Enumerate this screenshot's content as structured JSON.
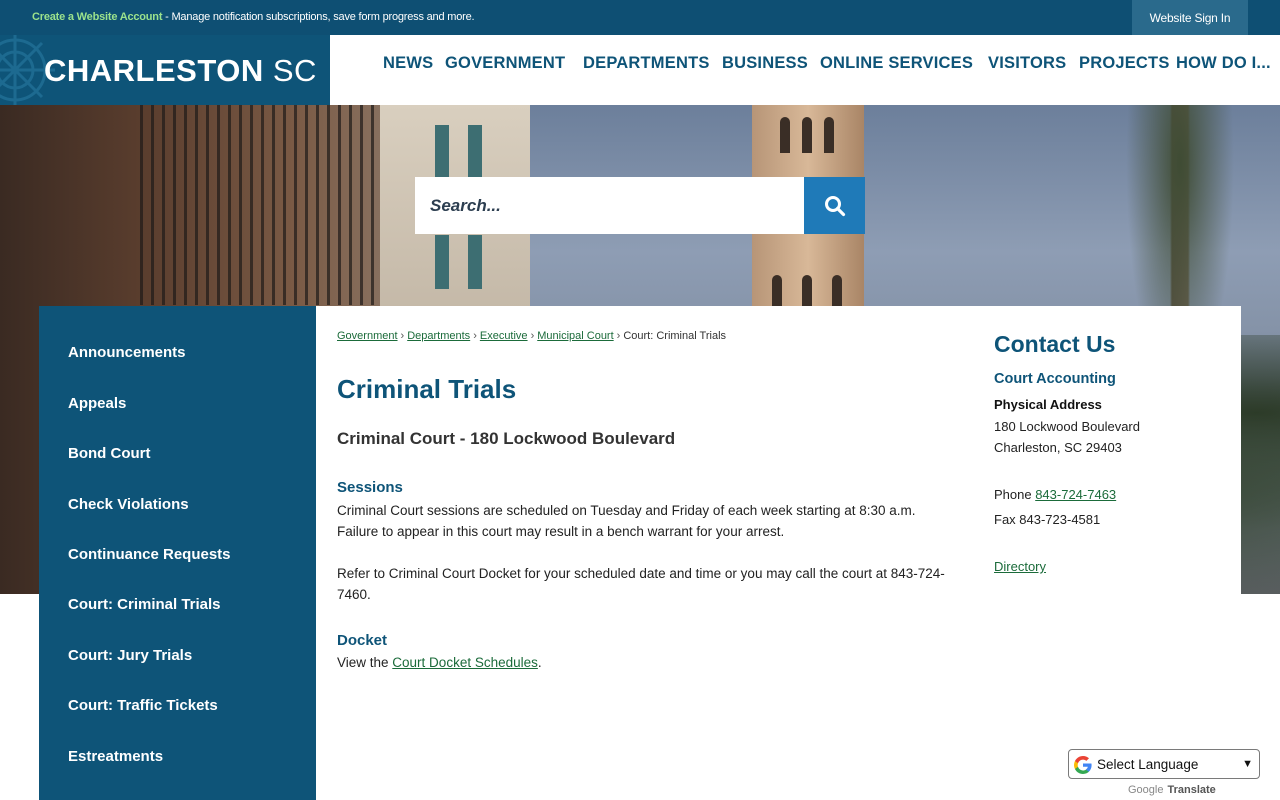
{
  "topbar": {
    "create_account_link": "Create a Website Account",
    "create_account_desc": " - Manage notification subscriptions, save form progress and more.",
    "sign_in": "Website Sign In"
  },
  "logo": {
    "brand": "CHARLESTON",
    "suffix": "SC"
  },
  "nav": [
    "NEWS",
    "GOVERNMENT",
    "DEPARTMENTS",
    "BUSINESS",
    "ONLINE SERVICES",
    "VISITORS",
    "PROJECTS",
    "HOW DO I..."
  ],
  "search": {
    "placeholder": "Search...",
    "icon": "search-icon"
  },
  "sidebar": {
    "items": [
      "Announcements",
      "Appeals",
      "Bond Court",
      "Check Violations",
      "Continuance Requests",
      "Court: Criminal Trials",
      "Court: Jury Trials",
      "Court: Traffic Tickets",
      "Estreatments"
    ]
  },
  "breadcrumb": {
    "items": [
      "Government",
      "Departments",
      "Executive",
      "Municipal Court"
    ],
    "current": "Court: Criminal Trials"
  },
  "main": {
    "title": "Criminal Trials",
    "subtitle": "Criminal Court - 180 Lockwood Boulevard",
    "sessions_heading": "Sessions",
    "sessions_text": "Criminal Court sessions are scheduled on Tuesday and Friday of each week starting at 8:30 a.m. Failure to appear in this court may result in a bench warrant for your arrest.",
    "docket_info_text": "Refer to Criminal Court Docket for your scheduled date and time or you may call the court at 843-724-7460.",
    "docket_heading": "Docket",
    "docket_prefix": "View the ",
    "docket_link": "Court Docket Schedules",
    "docket_suffix": "."
  },
  "contact": {
    "heading": "Contact Us",
    "department": "Court Accounting",
    "address_label": "Physical Address",
    "address_line1": "180 Lockwood Boulevard",
    "address_line2": "Charleston, SC 29403",
    "phone_label": "Phone ",
    "phone": "843-724-7463",
    "fax": "Fax 843-723-4581",
    "directory_link": "Directory"
  },
  "translate": {
    "select_label": "Select Language",
    "powered_google": "Google",
    "powered_translate": "Translate"
  },
  "colors": {
    "brand_blue": "#0e5478",
    "top_bar": "#0e4f73",
    "search_button": "#1f7ab8",
    "link_green": "#1b6b3a",
    "account_link_green": "#9be28c"
  }
}
